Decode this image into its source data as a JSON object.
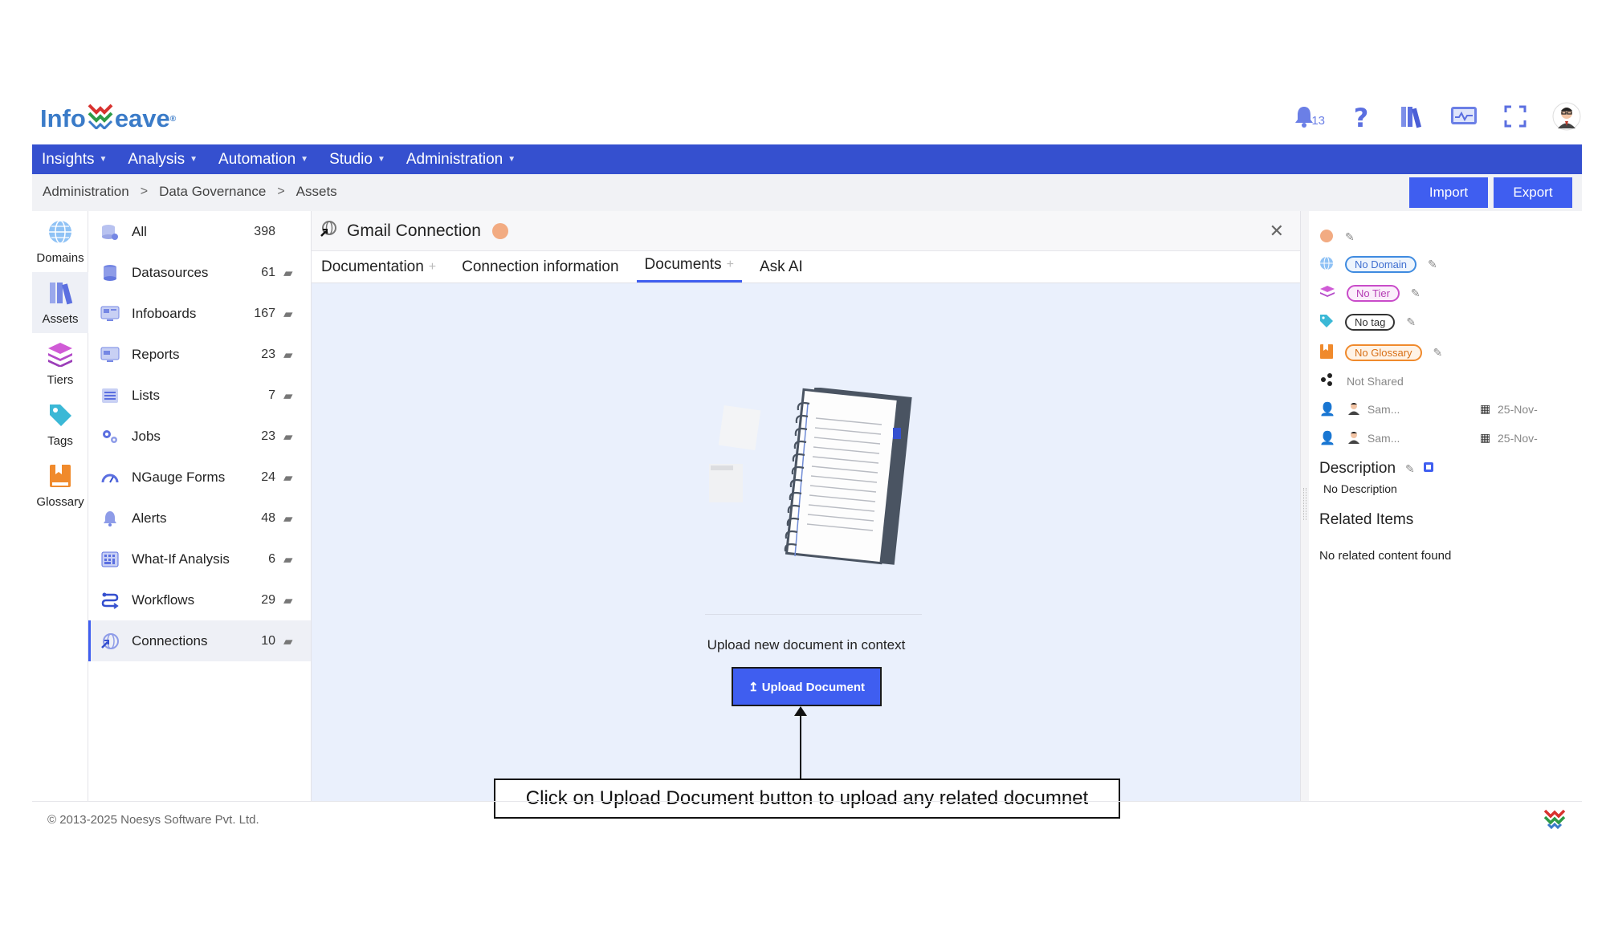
{
  "app": {
    "logo_text_left": "Info",
    "logo_text_right": "eave",
    "logo_reg": "®",
    "notification_count": "13",
    "colors": {
      "primary": "#3f5ef0",
      "menubar": "#3550cf",
      "accent_orange": "#f2ab82"
    }
  },
  "menu": [
    {
      "label": "Insights"
    },
    {
      "label": "Analysis"
    },
    {
      "label": "Automation"
    },
    {
      "label": "Studio"
    },
    {
      "label": "Administration"
    }
  ],
  "breadcrumb": [
    "Administration",
    "Data Governance",
    "Assets"
  ],
  "toolbar": {
    "import_label": "Import",
    "export_label": "Export"
  },
  "rail": [
    {
      "label": "Domains",
      "icon": "globe-icon"
    },
    {
      "label": "Assets",
      "icon": "books-icon"
    },
    {
      "label": "Tiers",
      "icon": "layers-icon"
    },
    {
      "label": "Tags",
      "icon": "tag-icon"
    },
    {
      "label": "Glossary",
      "icon": "book-icon"
    }
  ],
  "assets": [
    {
      "label": "All",
      "count": "398",
      "icon": "database-all-icon"
    },
    {
      "label": "Datasources",
      "count": "61",
      "icon": "database-icon"
    },
    {
      "label": "Infoboards",
      "count": "167",
      "icon": "dashboard-icon"
    },
    {
      "label": "Reports",
      "count": "23",
      "icon": "report-icon"
    },
    {
      "label": "Lists",
      "count": "7",
      "icon": "list-icon"
    },
    {
      "label": "Jobs",
      "count": "23",
      "icon": "gears-icon"
    },
    {
      "label": "NGauge Forms",
      "count": "24",
      "icon": "gauge-icon"
    },
    {
      "label": "Alerts",
      "count": "48",
      "icon": "bell-icon"
    },
    {
      "label": "What-If Analysis",
      "count": "6",
      "icon": "calculator-icon"
    },
    {
      "label": "Workflows",
      "count": "29",
      "icon": "workflow-icon"
    },
    {
      "label": "Connections",
      "count": "10",
      "icon": "connection-icon"
    }
  ],
  "panel": {
    "title": "Gmail Connection",
    "tabs": [
      {
        "label": "Documentation"
      },
      {
        "label": "Connection information"
      },
      {
        "label": "Documents"
      },
      {
        "label": "Ask AI"
      }
    ],
    "upload_text": "Upload new document in context",
    "upload_button": "↥ Upload Document"
  },
  "annotation": {
    "text": "Click on Upload Document button to upload any related documnet"
  },
  "right": {
    "domain": "No Domain",
    "tier": "No Tier",
    "tag": "No tag",
    "glossary": "No Glossary",
    "shared": "Not Shared",
    "owner_name": "Sam...",
    "owner_date": "25-Nov-",
    "modifier_name": "Sam...",
    "modifier_date": "25-Nov-",
    "description_title": "Description",
    "description_value": "No Description",
    "related_title": "Related Items",
    "related_value": "No related content found"
  },
  "footer": {
    "copyright": "© 2013-2025 Noesys Software Pvt. Ltd."
  }
}
